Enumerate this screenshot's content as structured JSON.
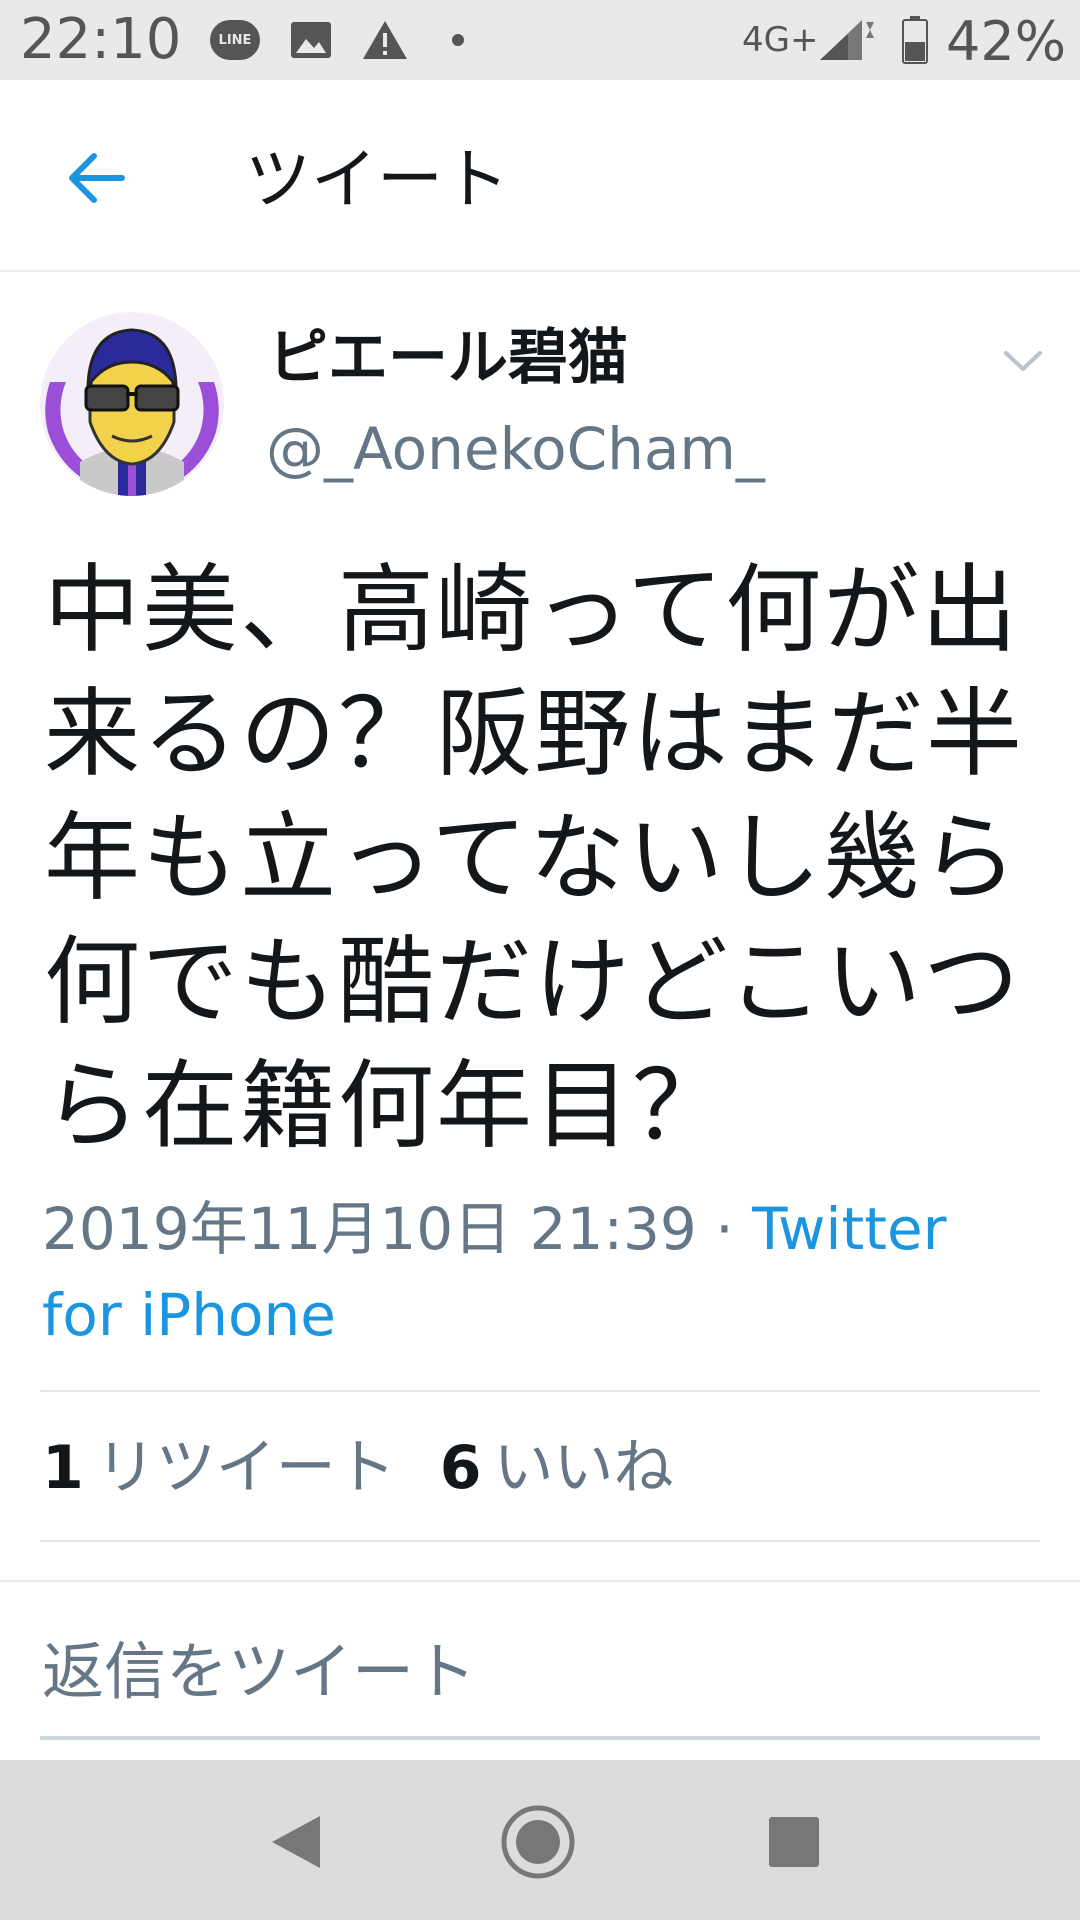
{
  "status_bar": {
    "time": "22:10",
    "line_badge": "LINE",
    "network": "4G+",
    "battery": "42%",
    "icons": [
      "line-icon",
      "image-icon",
      "warning-icon",
      "dot-icon",
      "signal-icon",
      "battery-icon"
    ]
  },
  "header": {
    "title": "ツイート",
    "back_icon": "arrow-left-icon"
  },
  "tweet": {
    "author_name": "ピエール碧猫",
    "author_handle": "@_AonekoCham_",
    "text_lines": [
      "中美、高崎って何が出",
      "来るの？阪野はまだ半",
      "年も立ってないし幾ら",
      "何でも酷だけどこいつ",
      "ら在籍何年目？"
    ],
    "timestamp": "2019年11月10日 21:39",
    "separator": "·",
    "client_part1": "Twitter",
    "client_part2": "for iPhone",
    "retweets_count": "1",
    "retweets_label": "リツイート",
    "likes_count": "6",
    "likes_label": "いいね"
  },
  "reply": {
    "placeholder": "返信をツイート"
  },
  "colors": {
    "accent": "#1b95e0",
    "secondary_text": "#657786",
    "avatar_ring": "#9b4fd8"
  }
}
